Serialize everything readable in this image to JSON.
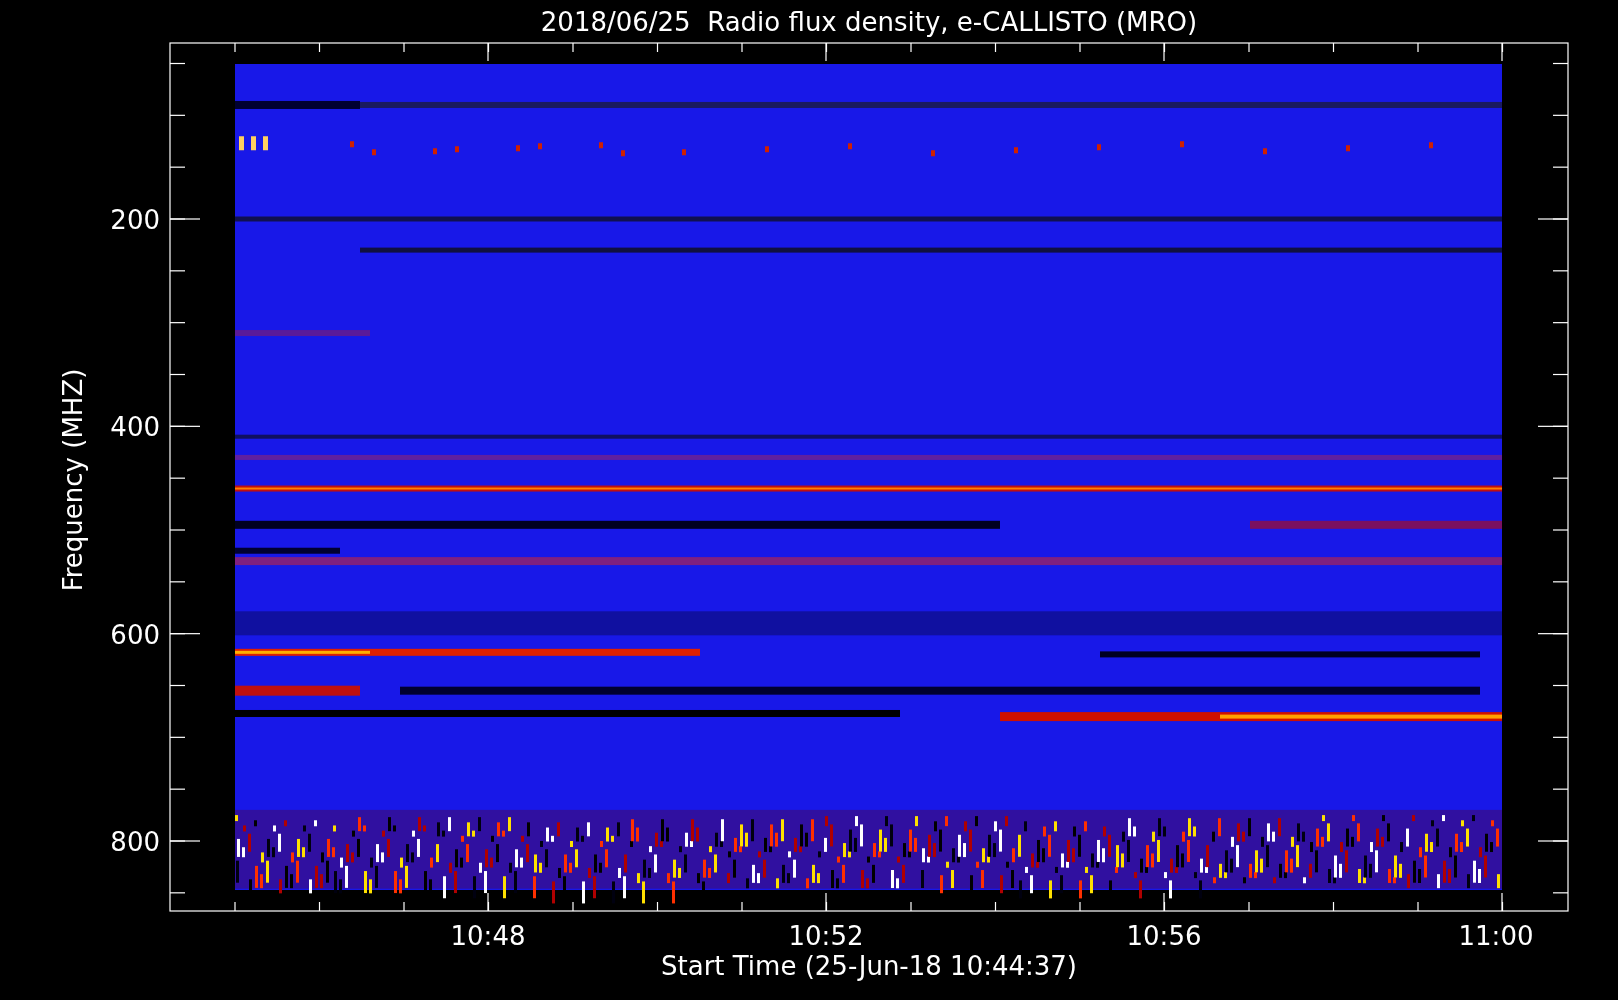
{
  "title": "2018/06/25  Radio flux density, e-CALLISTO (MRO)",
  "y_axis": {
    "label": "Frequency (MHZ)",
    "ticks": [
      "200",
      "400",
      "600",
      "800"
    ]
  },
  "x_axis": {
    "label": "Start Time (25-Jun-18 10:44:37)",
    "ticks": [
      "10:48",
      "10:52",
      "10:56",
      "11:00"
    ]
  }
}
